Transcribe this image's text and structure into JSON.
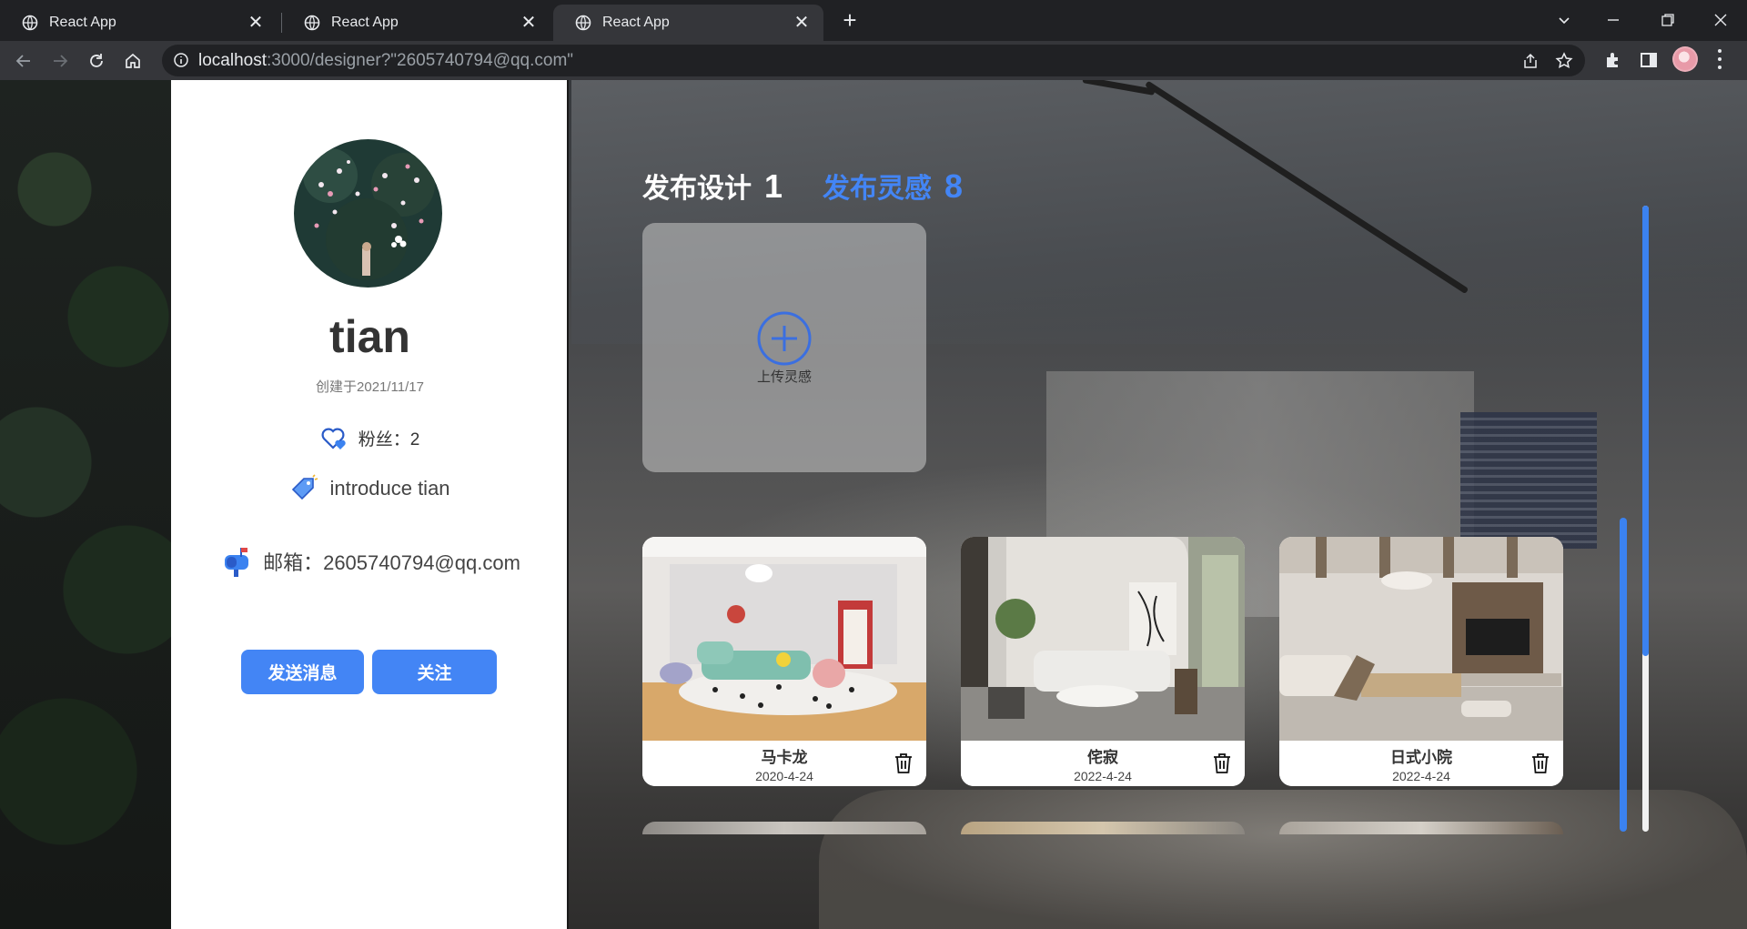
{
  "browser": {
    "tabs": [
      {
        "title": "React App",
        "close": "✕"
      },
      {
        "title": "React App",
        "close": "✕"
      },
      {
        "title": "React App",
        "close": "✕"
      }
    ],
    "new_tab": "+",
    "url_host": "localhost",
    "url_rest": ":3000/designer?\"2605740794@qq.com\""
  },
  "profile": {
    "name": "tian",
    "created": "创建于2021/11/17",
    "followers": "粉丝：2",
    "intro": "introduce tian",
    "email": "邮箱：2605740794@qq.com",
    "send_message": "发送消息",
    "follow": "关注"
  },
  "content": {
    "tab_designs": "发布设计",
    "tab_designs_count": "1",
    "tab_inspiration": "发布灵感",
    "tab_inspiration_count": "8",
    "upload_label": "上传灵感",
    "cards": [
      {
        "name": "马卡龙",
        "date": "2020-4-24"
      },
      {
        "name": "侘寂",
        "date": "2022-4-24"
      },
      {
        "name": "日式小院",
        "date": "2022-4-24"
      }
    ]
  },
  "colors": {
    "accent": "#4385f5",
    "panel": "#ffffff",
    "chrome": "#202124"
  }
}
